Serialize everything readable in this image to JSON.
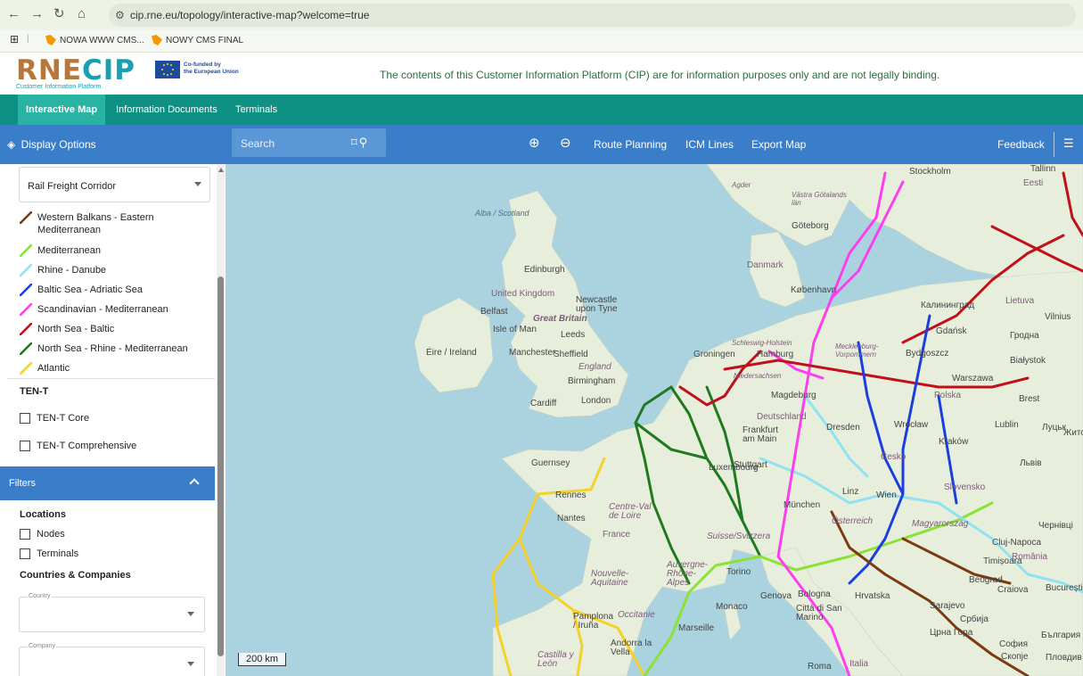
{
  "browser": {
    "url": "cip.rne.eu/topology/interactive-map?welcome=true",
    "bookmarks": [
      "NOWA WWW CMS...",
      "NOWY CMS FINAL"
    ]
  },
  "header": {
    "logo_text_left": "RNE",
    "logo_text_right": "CIP",
    "logo_tagline": "Customer Information Platform",
    "eu_line1": "Co-funded by",
    "eu_line2": "the European Union",
    "disclaimer": "The contents of this Customer Information Platform (CIP) are for information purposes only and are not legally binding."
  },
  "nav": {
    "items": [
      "Interactive Map",
      "Information Documents",
      "Terminals"
    ]
  },
  "sidebar": {
    "display_options": "Display Options",
    "corridor_select": "Rail Freight Corridor",
    "corridors": [
      {
        "label": "Western Balkans - Eastern Mediterranean",
        "color": "#7b3a10"
      },
      {
        "label": "Mediterranean",
        "color": "#8ae234"
      },
      {
        "label": "Rhine - Danube",
        "color": "#8fe3f0"
      },
      {
        "label": "Baltic Sea - Adriatic Sea",
        "color": "#1a3fe0"
      },
      {
        "label": "Scandinavian - Mediterranean",
        "color": "#ff3df0"
      },
      {
        "label": "North Sea - Baltic",
        "color": "#c0101a"
      },
      {
        "label": "North Sea - Rhine - Mediterranean",
        "color": "#1f7a1f"
      },
      {
        "label": "Atlantic",
        "color": "#f5d12a"
      }
    ],
    "tent_title": "TEN-T",
    "tent_core": "TEN-T Core",
    "tent_comprehensive": "TEN-T Comprehensive",
    "filters": "Filters",
    "locations": "Locations",
    "nodes": "Nodes",
    "terminals": "Terminals",
    "countries_companies": "Countries & Companies",
    "country_label": "Country",
    "company_label": "Company"
  },
  "toolbar": {
    "search": "Search",
    "route_planning": "Route Planning",
    "icm_lines": "ICM Lines",
    "export_map": "Export Map",
    "feedback": "Feedback"
  },
  "map": {
    "scale": "200 km",
    "labels": {
      "sea": [
        "Alba / Scotland"
      ],
      "country": [
        "United Kingdom",
        "Great Britain",
        "Danmark",
        "Deutschland",
        "France",
        "Česko",
        "Slovensko",
        "România",
        "Italia",
        "Eesti",
        "Lietuva",
        "Polska"
      ],
      "city": [
        "Stockholm",
        "Tallinn",
        "Göteborg",
        "Edinburgh",
        "Newcastle upon Tyne",
        "Belfast",
        "Isle of Man",
        "Leeds",
        "Éire / Ireland",
        "Manchester",
        "Sheffield",
        "England",
        "Birmingham",
        "Cardiff",
        "London",
        "Groningen",
        "Hamburg",
        "København",
        "Калининград",
        "Gdańsk",
        "Vilnius",
        "Гродна",
        "Bydgoszcz",
        "Warszawa",
        "Białystok",
        "Brest",
        "Magdeburg",
        "Dresden",
        "Wrocław",
        "Lublin",
        "Луцьк",
        "Житомир",
        "Frankfurt am Main",
        "Luxembourg",
        "Stuttgart",
        "München",
        "Linz",
        "Wien",
        "Kraków",
        "Львів",
        "Guernsey",
        "Rennes",
        "Nantes",
        "Centre-Val de Loire",
        "Nouvelle-Aquitaine",
        "Auvergne-Rhône-Alpes",
        "Occitanie",
        "Torino",
        "Genova",
        "Monaco",
        "Marseille",
        "Bologna",
        "Hrvatska",
        "Sarajevo",
        "Timișoara",
        "Beograd",
        "Cluj-Napoca",
        "Craiova",
        "București",
        "Чернівці",
        "Pamplona / Iruña",
        "Andorra la Vella",
        "Castilla y León",
        "Roma",
        "Црна Гора",
        "Скопје",
        "Пловдив",
        "България",
        "Schleswig-Holstein",
        "Mecklenburg-Vorpommern",
        "Niedersachsen",
        "Västra Götalands län",
        "Agder",
        "Suisse/Svizzera",
        "Österreich",
        "Magyarország",
        "Città di San Marino",
        "София",
        "Србија"
      ]
    }
  }
}
